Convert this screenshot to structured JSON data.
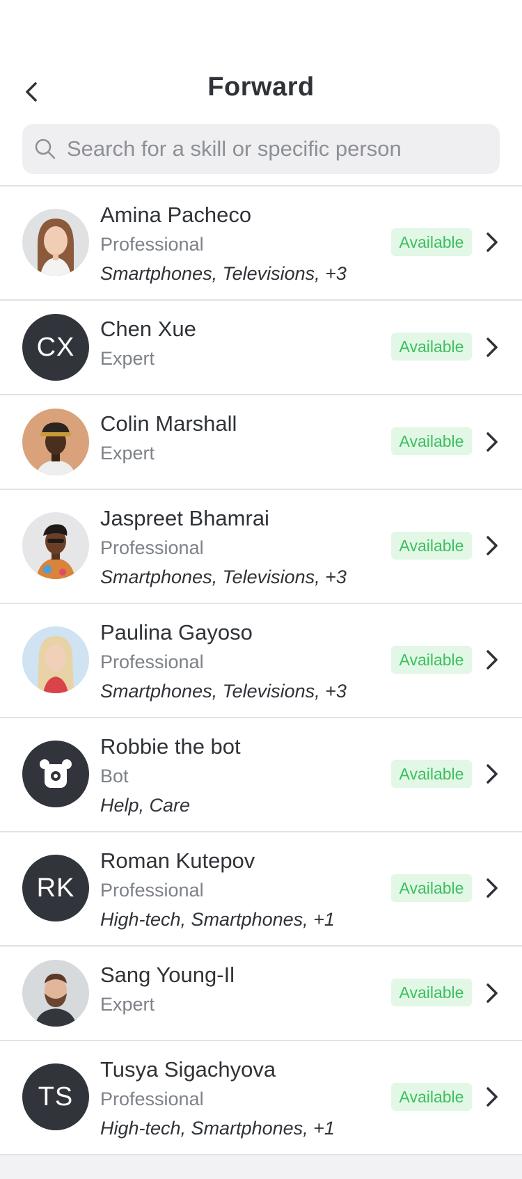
{
  "header": {
    "title": "Forward"
  },
  "search": {
    "placeholder": "Search for a skill or specific person",
    "value": ""
  },
  "status_color": "#3cbf5e",
  "contacts": [
    {
      "name": "Amina Pacheco",
      "role": "Professional",
      "skills": "Smartphones, Televisions, +3",
      "status": "Available"
    },
    {
      "name": "Chen Xue",
      "initials": "CX",
      "role": "Expert",
      "status": "Available"
    },
    {
      "name": "Colin Marshall",
      "role": "Expert",
      "status": "Available"
    },
    {
      "name": "Jaspreet Bhamrai",
      "role": "Professional",
      "skills": "Smartphones, Televisions, +3",
      "status": "Available"
    },
    {
      "name": "Paulina Gayoso",
      "role": "Professional",
      "skills": "Smartphones, Televisions, +3",
      "status": "Available"
    },
    {
      "name": "Robbie the bot",
      "role": "Bot",
      "skills": "Help, Care",
      "status": "Available"
    },
    {
      "name": "Roman Kutepov",
      "initials": "RK",
      "role": "Professional",
      "skills": "High-tech, Smartphones, +1",
      "status": "Available"
    },
    {
      "name": "Sang Young-Il",
      "role": "Expert",
      "status": "Available"
    },
    {
      "name": "Tusya Sigachyova",
      "initials": "TS",
      "role": "Professional",
      "skills": "High-tech, Smartphones, +1",
      "status": "Available"
    }
  ]
}
